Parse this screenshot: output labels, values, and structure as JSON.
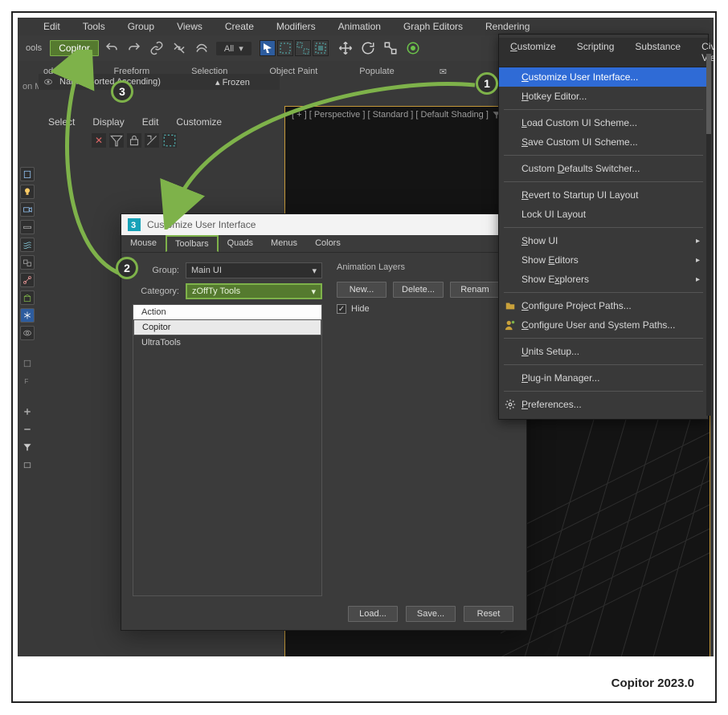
{
  "menubar": [
    "Edit",
    "Tools",
    "Group",
    "Views",
    "Create",
    "Modifiers",
    "Animation",
    "Graph Editors",
    "Rendering",
    "Customize",
    "Scripting",
    "Substance",
    "Civil View"
  ],
  "toolbar": {
    "left_label": "ools",
    "copitor": "Copitor",
    "all_pill": "All"
  },
  "ribbon": {
    "tabs": [
      "odeling",
      "Freeform",
      "Selection",
      "Object Paint",
      "Populate"
    ],
    "subline": "on Mode"
  },
  "scene": {
    "tabs": [
      "Select",
      "Display",
      "Edit",
      "Customize"
    ],
    "header_name": "Name (Sorted Ascending)",
    "header_frozen": "Frozen"
  },
  "viewport": {
    "label": "[ + ] [ Perspective ] [ Standard ] [ Default Shading ]"
  },
  "dropdown": {
    "head": [
      "Customize",
      "Scripting",
      "Substance",
      "Civil View"
    ],
    "items": [
      {
        "label": "Customize User Interface...",
        "hl": true,
        "u": "C"
      },
      {
        "label": "Hotkey Editor...",
        "u": "H"
      },
      {
        "sep": true
      },
      {
        "label": "Load Custom UI Scheme...",
        "u": "L"
      },
      {
        "label": "Save Custom UI Scheme...",
        "u": "S"
      },
      {
        "sep": true
      },
      {
        "label": "Custom Defaults Switcher...",
        "u": "D"
      },
      {
        "sep": true
      },
      {
        "label": "Revert to Startup UI Layout",
        "u": "R"
      },
      {
        "label": "Lock UI Layout"
      },
      {
        "sep": true
      },
      {
        "label": "Show UI",
        "sub": true,
        "u": "S"
      },
      {
        "label": "Show Editors",
        "sub": true,
        "u": "E"
      },
      {
        "label": "Show Explorers",
        "sub": true,
        "u": "x"
      },
      {
        "sep": true
      },
      {
        "label": "Configure Project Paths...",
        "icon": "folder",
        "u": "C"
      },
      {
        "label": "Configure User and System Paths...",
        "icon": "user",
        "u": "C"
      },
      {
        "sep": true
      },
      {
        "label": "Units Setup...",
        "u": "U"
      },
      {
        "sep": true
      },
      {
        "label": "Plug-in Manager...",
        "u": "P"
      },
      {
        "sep": true
      },
      {
        "label": "Preferences...",
        "icon": "gear",
        "u": "P"
      }
    ]
  },
  "cui": {
    "title": "Customize User Interface",
    "tabs": [
      "Mouse",
      "Toolbars",
      "Quads",
      "Menus",
      "Colors"
    ],
    "active_tab": 1,
    "group_label": "Group:",
    "group_value": "Main UI",
    "category_label": "Category:",
    "category_value": "zOffTy Tools",
    "actions": [
      "Action",
      "Copitor",
      "UltraTools"
    ],
    "anim_layers_label": "Animation Layers",
    "buttons_row": [
      "New...",
      "Delete...",
      "Renam"
    ],
    "hide_label": "Hide",
    "footer": [
      "Load...",
      "Save...",
      "Reset"
    ]
  },
  "badges": {
    "b1": "1",
    "b2": "2",
    "b3": "3"
  },
  "caption": "Copitor 2023.0"
}
